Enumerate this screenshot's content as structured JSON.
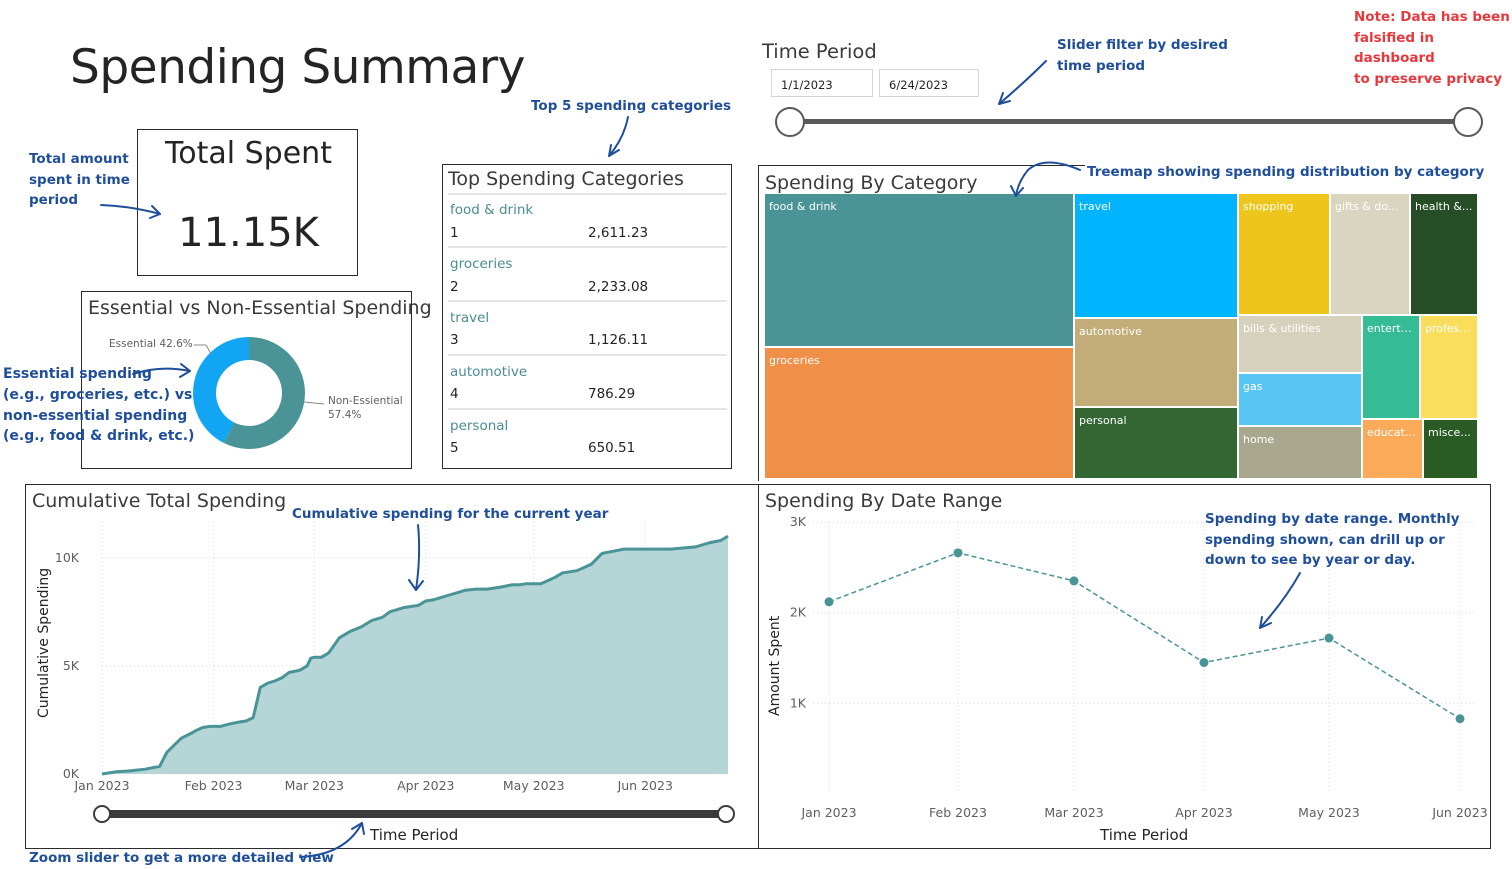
{
  "page": {
    "title": "Spending Summary"
  },
  "annotations": {
    "privacy_note": [
      "Note: Data has been",
      "falsified in dashboard",
      "to preserve privacy"
    ],
    "slider_note": [
      "Slider filter by desired",
      "time period"
    ],
    "top5_note": "Top 5 spending categories",
    "total_note": [
      "Total amount",
      "spent in time",
      "period"
    ],
    "treemap_note": "Treemap showing spending distribution by category",
    "essential_note": [
      "Essential spending",
      "(e.g., groceries, etc.) vs",
      "non-essential spending",
      "(e.g., food & drink, etc.)"
    ],
    "cumulative_note": "Cumulative spending for the current year",
    "date_range_note": [
      "Spending by date range.  Monthly",
      "spending shown, can drill up or",
      "down to see by year or day."
    ],
    "zoom_note": "Zoom slider to get a more detailed view"
  },
  "time_period": {
    "title": "Time Period",
    "start": "1/1/2023",
    "end": "6/24/2023"
  },
  "total_spent": {
    "title": "Total Spent",
    "value": "11.15K"
  },
  "top_categories": {
    "title": "Top Spending Categories",
    "rows": [
      {
        "name": "food & drink",
        "rank": "1",
        "value": "2,611.23"
      },
      {
        "name": "groceries",
        "rank": "2",
        "value": "2,233.08"
      },
      {
        "name": "travel",
        "rank": "3",
        "value": "1,126.11"
      },
      {
        "name": "automotive",
        "rank": "4",
        "value": "786.29"
      },
      {
        "name": "personal",
        "rank": "5",
        "value": "650.51"
      }
    ]
  },
  "essential": {
    "title": "Essential vs Non-Essential Spending",
    "essential_label": "Essential 42.6%",
    "non_essential_label": "Non-Essiential",
    "non_essential_pct": "57.4%",
    "colors": {
      "essential": "#11a5f4",
      "non_essential": "#4a9396"
    },
    "essential_pct_value": 42.6
  },
  "treemap": {
    "title": "Spending By Category",
    "cells": [
      {
        "label": "food & drink",
        "color": "#4a9396"
      },
      {
        "label": "groceries",
        "color": "#f08f48"
      },
      {
        "label": "travel",
        "color": "#00b4ff"
      },
      {
        "label": "automotive",
        "color": "#c2ad78"
      },
      {
        "label": "personal",
        "color": "#336633"
      },
      {
        "label": "shopping",
        "color": "#eec61b"
      },
      {
        "label": "gifts & do...",
        "color": "#d9d5c0"
      },
      {
        "label": "health &...",
        "color": "#264d26"
      },
      {
        "label": "bills & utilities",
        "color": "#d5d1bc"
      },
      {
        "label": "enterta...",
        "color": "#35bc95"
      },
      {
        "label": "profes...",
        "color": "#fadd5a"
      },
      {
        "label": "gas",
        "color": "#58c6f4"
      },
      {
        "label": "home",
        "color": "#a9a88f"
      },
      {
        "label": "educati...",
        "color": "#fbaa5a"
      },
      {
        "label": "misce...",
        "color": "#2a5b25"
      }
    ]
  },
  "cumulative": {
    "title": "Cumulative Total Spending",
    "ylabel": "Cumulative Spending",
    "xlabel": "Time Period",
    "colors": {
      "line": "#4a9396",
      "fill": "#b6d5d6"
    }
  },
  "date_range": {
    "title": "Spending By Date Range",
    "ylabel": "Amount Spent",
    "xlabel": "Time Period",
    "colors": {
      "line": "#4a9396"
    }
  },
  "chart_data": [
    {
      "type": "area",
      "title": "Cumulative Total Spending",
      "xlabel": "Time Period",
      "ylabel": "Cumulative Spending",
      "x_tick_labels": [
        "Jan 2023",
        "Feb 2023",
        "Mar 2023",
        "Apr 2023",
        "May 2023",
        "Jun 2023"
      ],
      "y_tick_labels": [
        "0K",
        "5K",
        "10K"
      ],
      "y_ticks": [
        0,
        5000,
        10000
      ],
      "ylim": [
        0,
        11700
      ],
      "x_range_days": [
        0,
        174
      ],
      "x_tick_days": [
        0,
        31,
        59,
        90,
        120,
        151
      ],
      "points_day": [
        0,
        4,
        8,
        12,
        16,
        18,
        22,
        25,
        26,
        28,
        30,
        33,
        35,
        38,
        40,
        42,
        44,
        46,
        48,
        50,
        52,
        55,
        57,
        58,
        59,
        61,
        63,
        66,
        69,
        72,
        75,
        78,
        80,
        84,
        88,
        90,
        92,
        95,
        97,
        99,
        101,
        104,
        107,
        111,
        114,
        116,
        118,
        122,
        126,
        128,
        132,
        136,
        139,
        142,
        145,
        148,
        152,
        158,
        165,
        169,
        172,
        174
      ],
      "points_value": [
        0,
        100,
        150,
        220,
        350,
        1000,
        1650,
        1900,
        2000,
        2150,
        2200,
        2200,
        2300,
        2400,
        2450,
        2600,
        4000,
        4200,
        4300,
        4450,
        4700,
        4800,
        5000,
        5350,
        5400,
        5400,
        5600,
        6300,
        6600,
        6800,
        7100,
        7250,
        7500,
        7700,
        7800,
        8000,
        8050,
        8200,
        8300,
        8400,
        8500,
        8550,
        8550,
        8650,
        8750,
        8750,
        8800,
        8800,
        9100,
        9300,
        9400,
        9700,
        10200,
        10300,
        10400,
        10400,
        10400,
        10400,
        10500,
        10700,
        10800,
        11000
      ]
    },
    {
      "type": "line",
      "title": "Spending By Date Range",
      "xlabel": "Time Period",
      "ylabel": "Amount Spent",
      "categories": [
        "Jan 2023",
        "Feb 2023",
        "Mar 2023",
        "Apr 2023",
        "May 2023",
        "Jun 2023"
      ],
      "values": [
        2120,
        2660,
        2350,
        1450,
        1720,
        830
      ],
      "y_tick_labels": [
        "1K",
        "2K",
        "3K"
      ],
      "y_ticks": [
        1000,
        2000,
        3000
      ],
      "ylim": [
        0,
        3000
      ],
      "line_style": "dashed"
    },
    {
      "type": "pie",
      "title": "Essential vs Non-Essential Spending",
      "labels": [
        "Essential",
        "Non-Essiential"
      ],
      "values": [
        42.6,
        57.4
      ]
    }
  ]
}
